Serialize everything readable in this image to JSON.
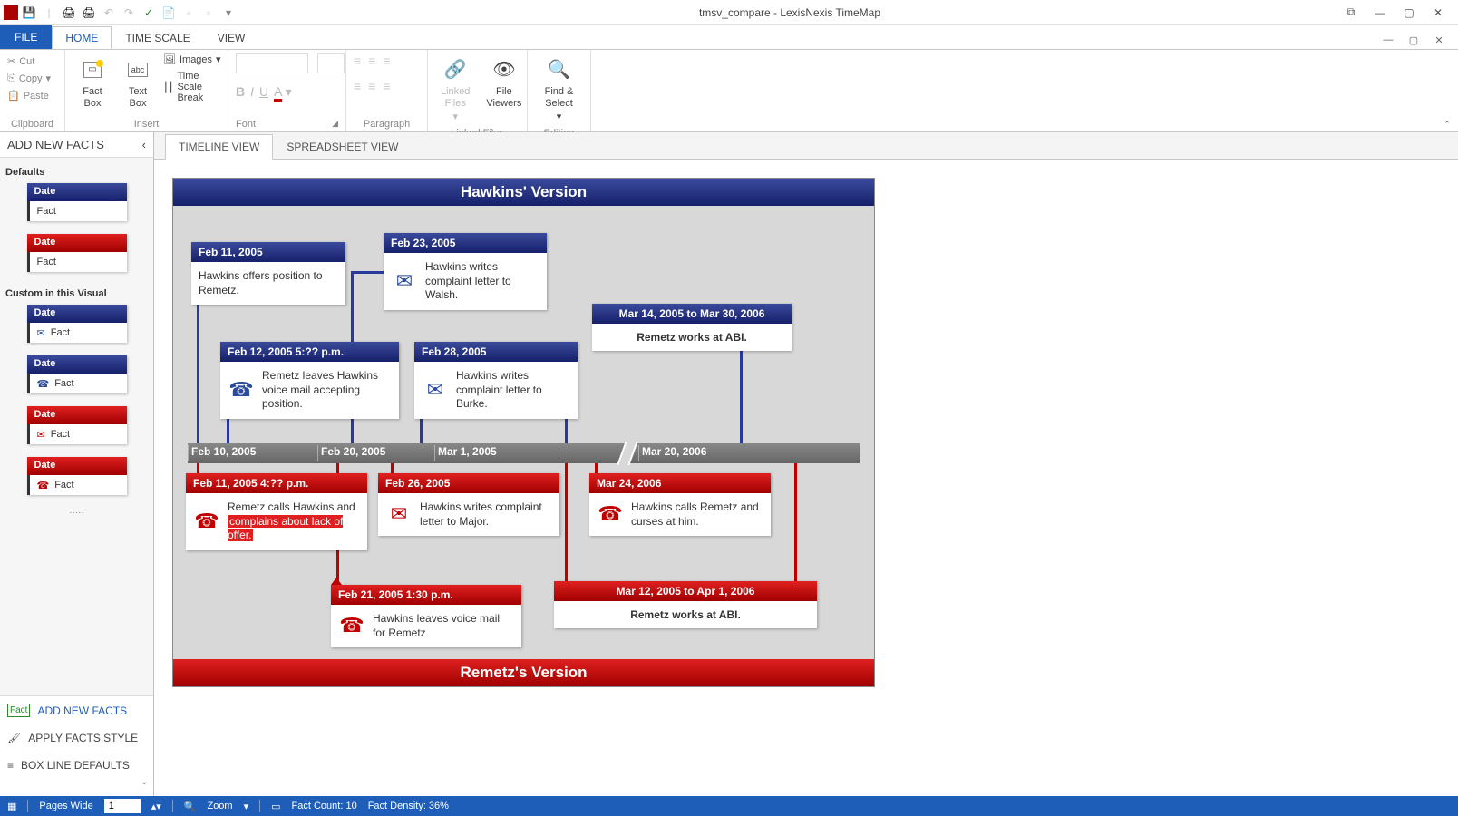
{
  "app": {
    "title": "tmsv_compare - LexisNexis TimeMap"
  },
  "tabs": {
    "file": "FILE",
    "home": "HOME",
    "timescale": "TIME SCALE",
    "view": "VIEW"
  },
  "ribbon": {
    "clipboard": {
      "cut": "Cut",
      "copy": "Copy",
      "paste": "Paste",
      "label": "Clipboard"
    },
    "insert": {
      "factbox": "Fact Box",
      "textbox": "Text Box",
      "images": "Images",
      "timescalebreak": "Time Scale Break",
      "label": "Insert"
    },
    "font": {
      "label": "Font"
    },
    "paragraph": {
      "label": "Paragraph"
    },
    "linkedfiles": {
      "linked": "Linked Files",
      "viewers": "File Viewers",
      "label": "Linked Files"
    },
    "editing": {
      "find": "Find & Select",
      "label": "Editing"
    }
  },
  "sidebar": {
    "heading": "ADD NEW FACTS",
    "section_defaults": "Defaults",
    "section_custom": "Custom in this Visual",
    "date_label": "Date",
    "fact_label": "Fact",
    "links": {
      "addnew": "ADD NEW FACTS",
      "applystyle": "APPLY FACTS STYLE",
      "boxline": "BOX LINE DEFAULTS"
    }
  },
  "view_tabs": {
    "timeline": "TIMELINE VIEW",
    "spreadsheet": "SPREADSHEET VIEW"
  },
  "timeline": {
    "top_title": "Hawkins' Version",
    "bottom_title": "Remetz's Version",
    "axis": [
      "Feb 10, 2005",
      "Feb 20, 2005",
      "Mar 1, 2005",
      "Mar 20, 2006"
    ],
    "facts_top": {
      "f1": {
        "date": "Feb 11, 2005",
        "text": "Hawkins offers position to Remetz."
      },
      "f2": {
        "date": "Feb 23, 2005",
        "text": "Hawkins writes complaint letter to Walsh."
      },
      "f3": {
        "date": "Feb 12, 2005 5:?? p.m.",
        "text": "Remetz leaves Hawkins voice mail accepting position."
      },
      "f4": {
        "date": "Feb 28, 2005",
        "text": "Hawkins writes complaint letter to Burke."
      },
      "r1": {
        "date": "Mar 14, 2005 to Mar 30, 2006",
        "text": "Remetz works at ABI."
      }
    },
    "facts_bottom": {
      "f1": {
        "date": "Feb 11, 2005 4:?? p.m.",
        "text_a": "Remetz calls Hawkins and ",
        "text_hl": "complains about lack of offer."
      },
      "f2": {
        "date": "Feb 26, 2005",
        "text": "Hawkins writes complaint letter to Major."
      },
      "f3": {
        "date": "Feb 21, 2005 1:30 p.m.",
        "text": "Hawkins leaves voice mail for Remetz"
      },
      "f4": {
        "date": "Mar 24, 2006",
        "text": "Hawkins calls Remetz and curses at him."
      },
      "r1": {
        "date": "Mar 12, 2005 to Apr 1, 2006",
        "text": "Remetz works at ABI."
      }
    }
  },
  "status": {
    "pages": "Pages Wide",
    "pages_val": "1",
    "zoom": "Zoom",
    "factcount": "Fact Count: 10",
    "factdensity": "Fact Density: 36%"
  }
}
